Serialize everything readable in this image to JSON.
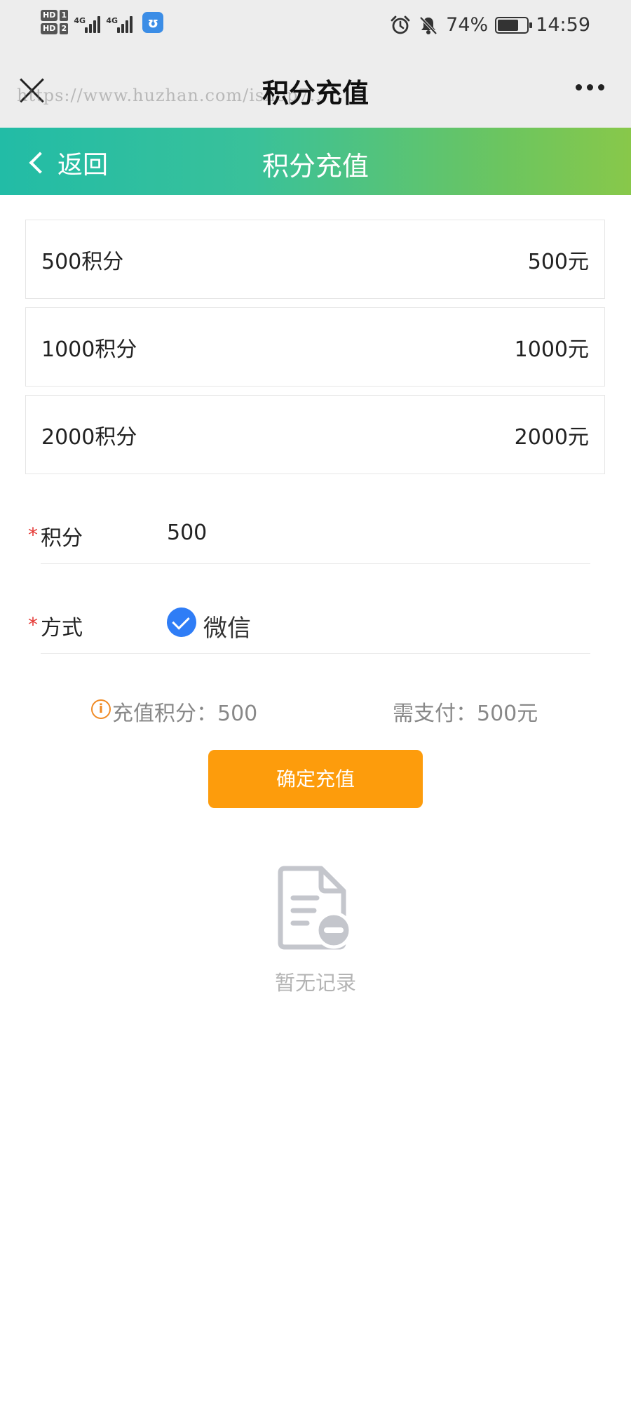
{
  "status_bar": {
    "hd1": "HD",
    "hd1_num": "1",
    "hd2": "HD",
    "hd2_num": "2",
    "net1": "4G",
    "net2": "4G",
    "app_badge": "ʊ",
    "battery_percent": "74%",
    "battery_level": 0.74,
    "time": "14:59"
  },
  "title_bar": {
    "title": "积分充值",
    "watermark": "https://www.huzhan.com/ishop7..."
  },
  "header": {
    "back_label": "返回",
    "title": "积分充值"
  },
  "packages": [
    {
      "points": "500积分",
      "price": "500元"
    },
    {
      "points": "1000积分",
      "price": "1000元"
    },
    {
      "points": "2000积分",
      "price": "2000元"
    }
  ],
  "form": {
    "required_mark": "*",
    "points_label": "积分",
    "points_value": "500",
    "method_label": "方式",
    "method_value": "微信"
  },
  "summary": {
    "info_glyph": "i",
    "points_text": "充值积分：500",
    "pay_text": "需支付：500元"
  },
  "confirm_button": "确定充值",
  "empty_state": "暂无记录",
  "colors": {
    "header_start": "#22bca6",
    "header_end": "#88c84a",
    "confirm": "#fd9c0c",
    "check": "#2f7df6",
    "required": "#e53935",
    "info": "#f08a24"
  }
}
